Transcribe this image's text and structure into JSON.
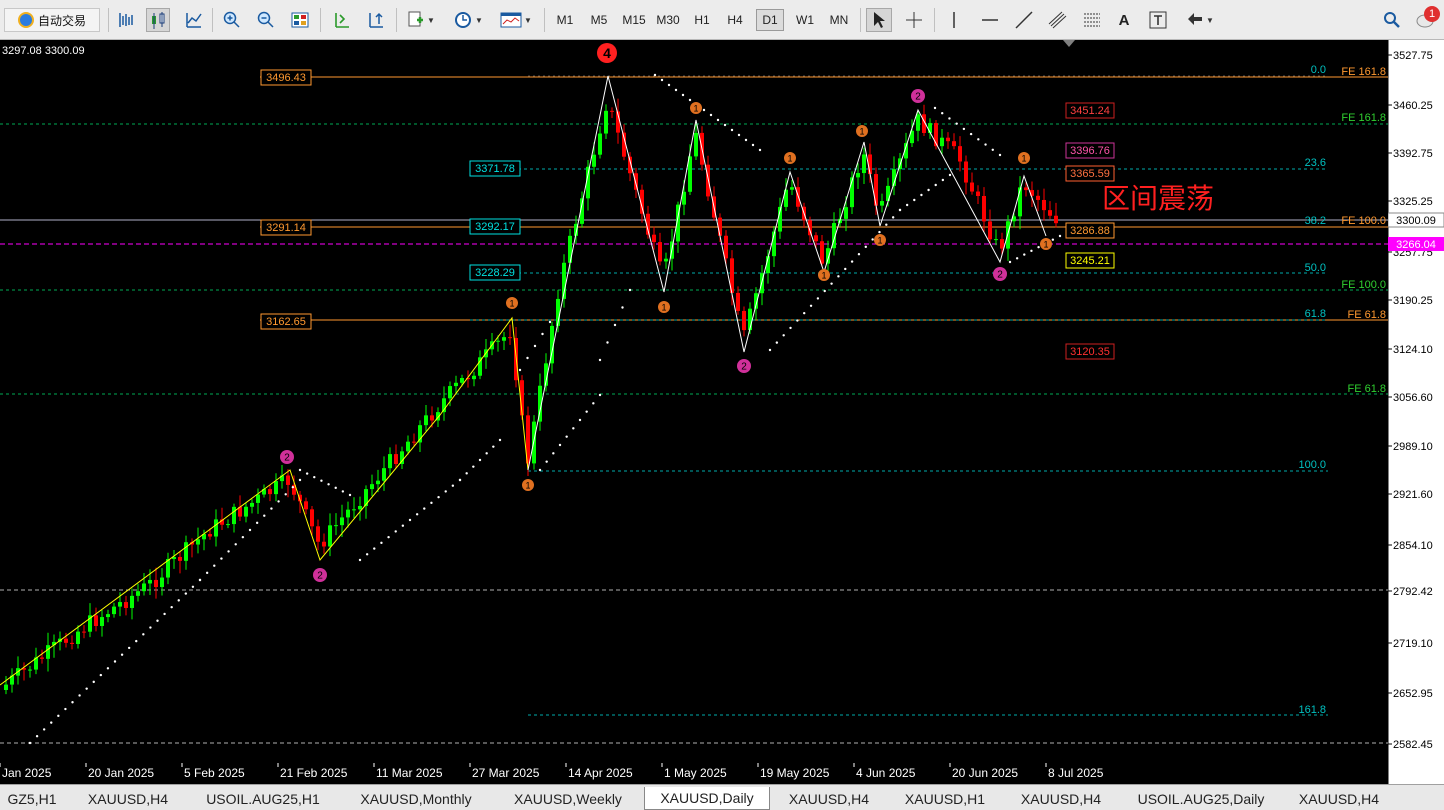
{
  "toolbar": {
    "autotrade_label": "自动交易",
    "timeframes": [
      "M1",
      "M5",
      "M15",
      "M30",
      "H1",
      "H4",
      "D1",
      "W1",
      "MN"
    ],
    "active_timeframe": "D1",
    "notification_count": "1",
    "text_tool_label": "A"
  },
  "chart": {
    "ohlc_header": "3297.08 3300.09",
    "annotation_text": "区间震荡",
    "wave_labels": {
      "big4": "4",
      "one": "1",
      "two": "2"
    },
    "fib_levels": [
      "0.0",
      "23.6",
      "38.2",
      "50.0",
      "61.8",
      "100.0",
      "161.8"
    ],
    "fe_levels": [
      "FE 161.8",
      "FE 161.8",
      "FE 100.0",
      "FE 100.0",
      "FE 61.8",
      "FE 61.8"
    ],
    "price_boxes_left": [
      "3496.43",
      "3291.14",
      "3162.65"
    ],
    "price_boxes_mid": [
      "3371.78",
      "3292.17",
      "3228.29"
    ],
    "price_boxes_right": [
      "3451.24",
      "3396.76",
      "3365.59",
      "3286.88",
      "3245.21",
      "3120.35"
    ],
    "colors": {
      "bull": "#00ff00",
      "bear": "#ff0000",
      "fib": "#00c0c0",
      "fe": "#ff9930",
      "magenta": "#ff00ff"
    }
  },
  "price_axis": {
    "ticks": [
      "3527.75",
      "3460.25",
      "3392.75",
      "3325.25",
      "3257.75",
      "3190.25",
      "3124.10",
      "3056.60",
      "2989.10",
      "2921.60",
      "2854.10",
      "2792.42",
      "2719.10",
      "2652.95",
      "2582.45"
    ],
    "current_price": "3300.09",
    "marker_price": "3266.04"
  },
  "time_axis": {
    "labels": [
      "Jan 2025",
      "20 Jan 2025",
      "5 Feb 2025",
      "21 Feb 2025",
      "11 Mar 2025",
      "27 Mar 2025",
      "14 Apr 2025",
      "1 May 2025",
      "19 May 2025",
      "4 Jun 2025",
      "20 Jun 2025",
      "8 Jul 2025"
    ]
  },
  "tabs": [
    "GZ5,H1",
    "XAUUSD,H4",
    "USOIL.AUG25,H1",
    "XAUUSD,Monthly",
    "XAUUSD,Weekly",
    "XAUUSD,Daily",
    "XAUUSD,H4",
    "XAUUSD,H1",
    "XAUUSD,H4",
    "USOIL.AUG25,Daily",
    "XAUUSD,H4"
  ],
  "active_tab": "XAUUSD,Daily"
}
